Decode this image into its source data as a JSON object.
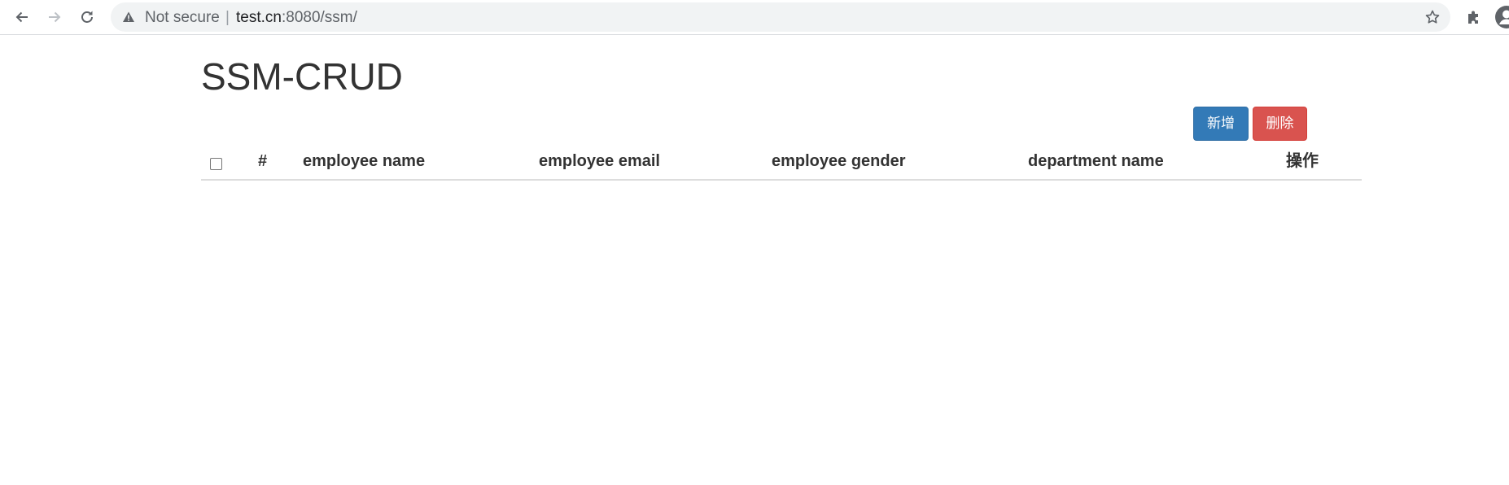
{
  "browser": {
    "security_label": "Not secure",
    "separator": "|",
    "url_host": "test.cn",
    "url_rest": ":8080/ssm/",
    "icons": {
      "back": "arrow-left-icon",
      "forward": "arrow-right-icon",
      "reload": "reload-icon",
      "warning": "warning-triangle-icon",
      "bookmark": "star-icon",
      "extensions": "puzzle-icon",
      "profile": "profile-avatar-icon"
    }
  },
  "page": {
    "title": "SSM-CRUD"
  },
  "actions": {
    "add_label": "新增",
    "delete_label": "删除",
    "add_color": "#337ab7",
    "delete_color": "#d9534f"
  },
  "table": {
    "columns": [
      "#",
      "employee name",
      "employee email",
      "employee gender",
      "department name",
      "操作"
    ],
    "rows": []
  }
}
